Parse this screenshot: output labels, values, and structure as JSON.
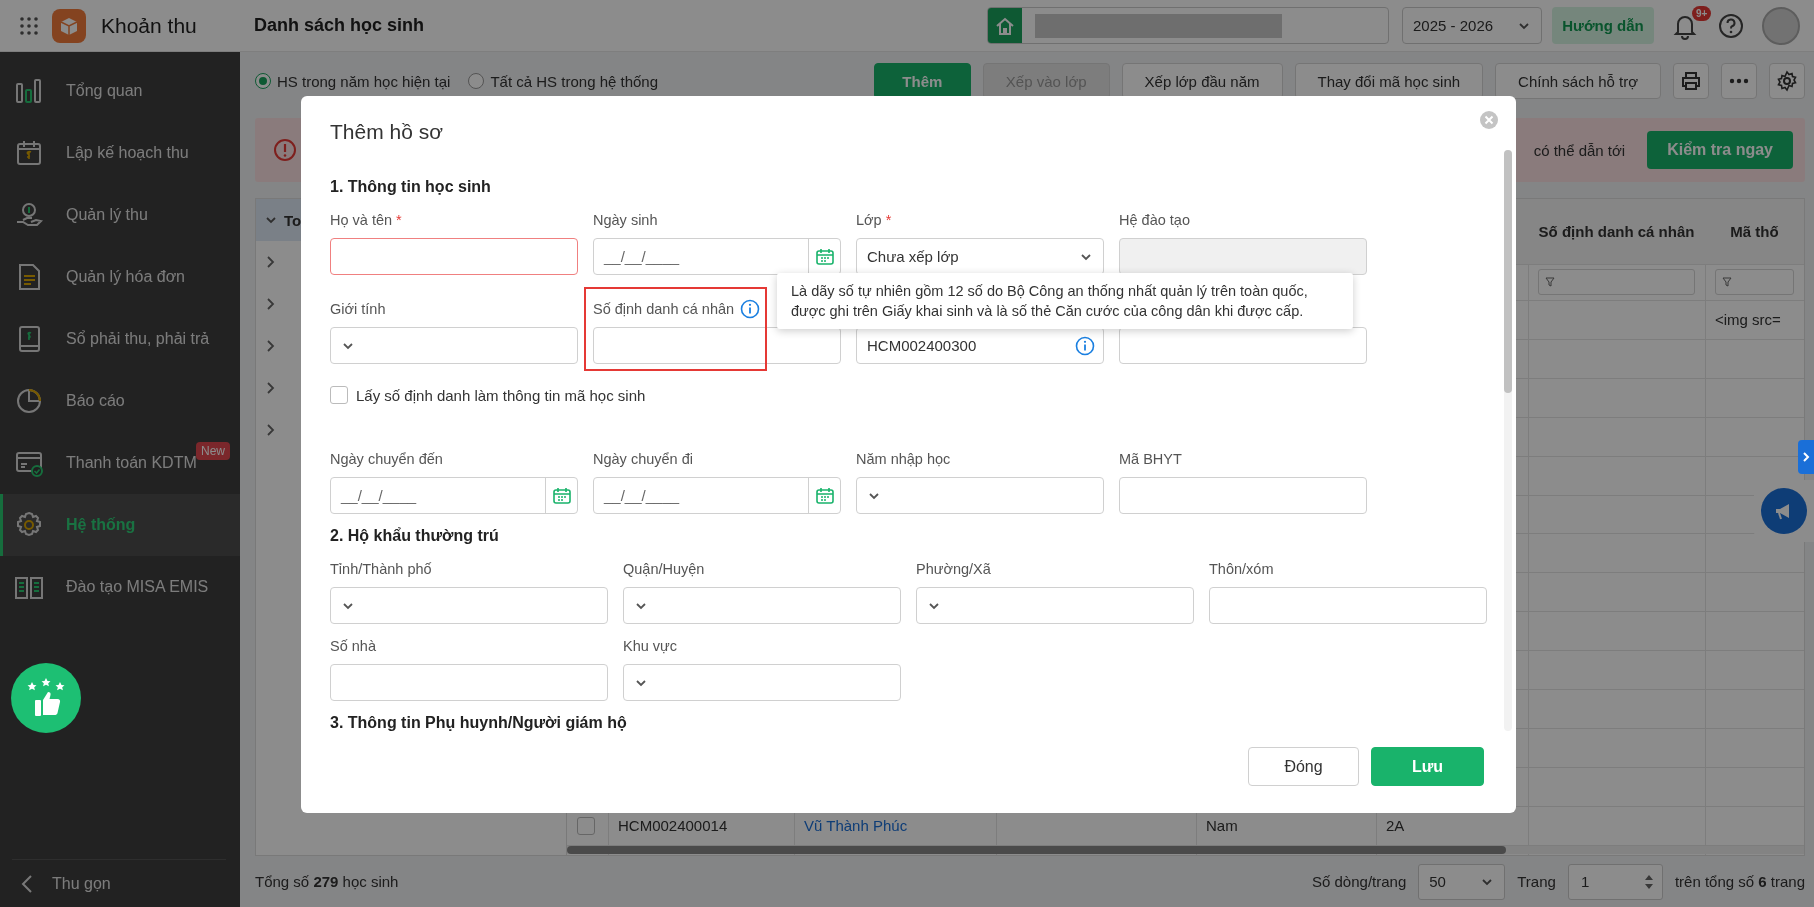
{
  "app": {
    "title": "Khoản thu"
  },
  "page_title": "Danh sách học sinh",
  "topbar": {
    "year": "2025 - 2026",
    "guide_button": "Hướng dẫn",
    "notification_badge": "9+"
  },
  "sidebar": {
    "items": [
      {
        "label": "Tổng quan",
        "selected": false
      },
      {
        "label": "Lập kế hoạch thu",
        "selected": false
      },
      {
        "label": "Quản lý thu",
        "selected": false
      },
      {
        "label": "Quản lý hóa đơn",
        "selected": false
      },
      {
        "label": "Sổ phải thu, phải trả",
        "selected": false
      },
      {
        "label": "Báo cáo",
        "selected": false
      },
      {
        "label": "Thanh toán KDTM",
        "selected": false,
        "badge": "New"
      },
      {
        "label": "Hệ thống",
        "selected": true
      },
      {
        "label": "Đào tạo MISA EMIS",
        "selected": false
      }
    ],
    "collapse": "Thu gọn"
  },
  "toolbar": {
    "scope_options": [
      {
        "label": "HS trong năm học hiện tại",
        "selected": true
      },
      {
        "label": "Tất cả HS trong hệ thống",
        "selected": false
      }
    ],
    "buttons": [
      {
        "label": "Thêm",
        "kind": "primary"
      },
      {
        "label": "Xếp vào lớp",
        "kind": "disabled"
      },
      {
        "label": "Xếp lớp đầu năm",
        "kind": "default"
      },
      {
        "label": "Thay đổi mã học sinh",
        "kind": "default"
      },
      {
        "label": "Chính sách hỗ trợ",
        "kind": "default"
      }
    ]
  },
  "alert": {
    "text": "có thể dẫn tới",
    "button": "Kiểm tra ngay"
  },
  "table": {
    "group_header": "To",
    "group_rows": [
      {
        "expanded": false
      },
      {
        "expanded": false
      },
      {
        "expanded": false
      },
      {
        "expanded": false
      },
      {
        "expanded": false
      }
    ],
    "columns": [
      {
        "label": "Số định danh cá nhân"
      },
      {
        "label": "Mã thố"
      }
    ],
    "first_row": {
      "column_2": "<img src="
    },
    "last_row": {
      "selected": false,
      "code": "HCM002400014",
      "name": "Vũ Thành Phúc",
      "gender": "Nam",
      "class": "2A"
    }
  },
  "footer": {
    "total": "Tổng số **279** học sinh",
    "rows_per_page_label": "Số dòng/trang",
    "rows_per_page": "50",
    "page_label": "Trang",
    "page": "1",
    "total_pages": "trên tổng số **6** trang"
  },
  "dialog": {
    "title": "Thêm hồ sơ",
    "footer_buttons": [
      {
        "label": "Đóng",
        "kind": "default"
      },
      {
        "label": "Lưu",
        "kind": "primary"
      }
    ],
    "tooltip": {
      "lines": [
        "Là dãy số tự nhiên gồm 12 số do Bộ Công an thống nhất quản lý trên toàn quốc,",
        "được ghi trên Giấy khai sinh và là số thẻ Căn cước của công dân khi được cấp."
      ]
    },
    "sections": [
      {
        "title": "1. Thông tin học sinh",
        "items": [
          {
            "kind": "text",
            "label": "Họ và tên",
            "required_mark": "*",
            "invalid": true
          },
          {
            "kind": "date",
            "label": "Ngày sinh",
            "placeholder": "__/__/____"
          },
          {
            "kind": "select",
            "label": "Lớp",
            "required_mark": "*",
            "value": "Chưa xếp lớp"
          },
          {
            "kind": "readonly",
            "label": "Hệ đào tạo"
          },
          {
            "kind": "select",
            "label": "Giới tính"
          },
          {
            "kind": "text",
            "label": "Số định danh cá nhân",
            "label_info": true,
            "highlight": true
          },
          {
            "kind": "text",
            "value": "HCM002400300",
            "info": true
          },
          {
            "kind": "text"
          },
          {
            "kind": "checkbox",
            "label": "Lấy số định danh làm thông tin mã học sinh",
            "checked": false
          },
          {
            "kind": "date",
            "label": "Ngày chuyển đến",
            "placeholder": "__/__/____"
          },
          {
            "kind": "date",
            "label": "Ngày chuyển đi",
            "placeholder": "__/__/____"
          },
          {
            "kind": "select",
            "label": "Năm nhập học"
          },
          {
            "kind": "text",
            "label": "Mã BHYT"
          }
        ]
      },
      {
        "title": "2. Hộ khẩu thường trú",
        "items": [
          {
            "kind": "select",
            "label": "Tỉnh/Thành phố"
          },
          {
            "kind": "select",
            "label": "Quận/Huyện"
          },
          {
            "kind": "select",
            "label": "Phường/Xã"
          },
          {
            "kind": "text",
            "label": "Thôn/xóm"
          },
          {
            "kind": "text",
            "label": "Số nhà"
          },
          {
            "kind": "select",
            "label": "Khu vực"
          }
        ]
      },
      {
        "title": "3. Thông tin Phụ huynh/Người giám hộ"
      }
    ]
  }
}
